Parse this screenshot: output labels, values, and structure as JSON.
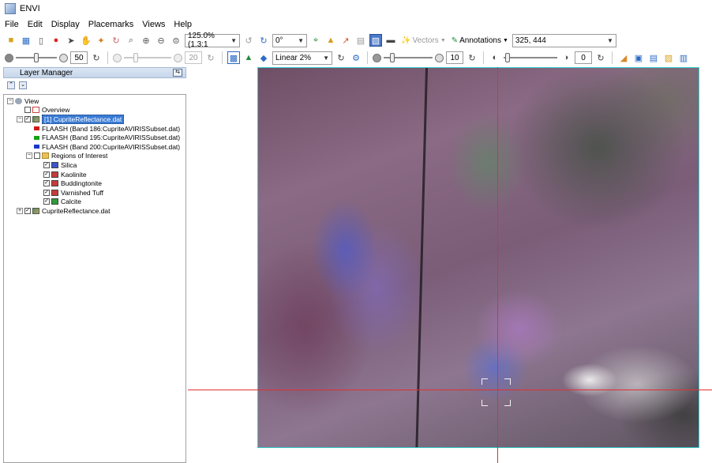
{
  "window": {
    "title": "ENVI"
  },
  "menu": [
    "File",
    "Edit",
    "Display",
    "Placemarks",
    "Views",
    "Help"
  ],
  "toolbar1": {
    "zoom_value": "125.0% (1.3:1",
    "rotation_value": "0°",
    "vectors_label": "Vectors",
    "annotations_label": "Annotations",
    "location_value": "325, 444"
  },
  "toolbar2": {
    "brightness_value": "50",
    "contrast_value": "20",
    "stretch_value": "Linear 2%",
    "sharpen_value": "10",
    "transparency_value": "0"
  },
  "layer_manager": {
    "title": "Layer Manager",
    "tree": [
      {
        "label": "View",
        "indent": 0,
        "kind": "view",
        "expander": "−",
        "check": false
      },
      {
        "label": "Overview",
        "indent": 1,
        "kind": "overview",
        "expander": "",
        "check": true,
        "checked": false
      },
      {
        "label": "[1] CupriteReflectance.dat",
        "indent": 1,
        "kind": "raster",
        "expander": "−",
        "check": true,
        "checked": true,
        "selected": true
      },
      {
        "label": "FLAASH (Band 186:CupriteAVIRISSubset.dat)",
        "indent": 2,
        "kind": "band",
        "color": "#d01818"
      },
      {
        "label": "FLAASH (Band 195:CupriteAVIRISSubset.dat)",
        "indent": 2,
        "kind": "band",
        "color": "#18a018"
      },
      {
        "label": "FLAASH (Band 200:CupriteAVIRISSubset.dat)",
        "indent": 2,
        "kind": "band",
        "color": "#1838c8"
      },
      {
        "label": "Regions of Interest",
        "indent": 2,
        "kind": "folder",
        "expander": "−",
        "check": true,
        "checked": false
      },
      {
        "label": "Silica",
        "indent": 3,
        "kind": "roi",
        "check": true,
        "checked": true,
        "color": "#3a54c8"
      },
      {
        "label": "Kaolinite",
        "indent": 3,
        "kind": "roi",
        "check": true,
        "checked": true,
        "color": "#c83a3a"
      },
      {
        "label": "Buddingtonite",
        "indent": 3,
        "kind": "roi",
        "check": true,
        "checked": true,
        "color": "#c83a3a"
      },
      {
        "label": "Varnished Tuff",
        "indent": 3,
        "kind": "roi",
        "check": true,
        "checked": true,
        "color": "#c83a3a"
      },
      {
        "label": "Calcite",
        "indent": 3,
        "kind": "roi",
        "check": true,
        "checked": true,
        "color": "#2f9a3a"
      },
      {
        "label": "CupriteReflectance.dat",
        "indent": 1,
        "kind": "raster",
        "expander": "+",
        "check": true,
        "checked": true
      }
    ]
  }
}
